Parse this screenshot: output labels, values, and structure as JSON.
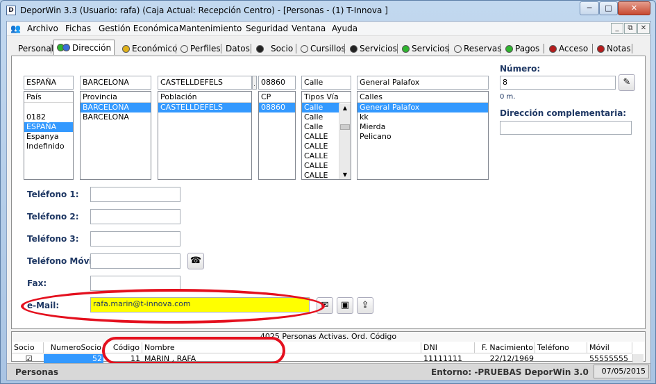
{
  "window": {
    "title": "DeporWin 3.3  (Usuario: rafa)  (Caja Actual: Recepción Centro) - [Personas - (1) T-Innova ]",
    "app_icon": "D",
    "controls": [
      "─",
      "□",
      "✕"
    ]
  },
  "menu": {
    "items": [
      "Archivo",
      "Fichas",
      "Gestión Económica",
      "Mantenimiento",
      "Seguridad",
      "Ventana",
      "Ayuda"
    ],
    "mdi_controls": [
      "_",
      "⧉",
      "✕"
    ]
  },
  "tabs": [
    {
      "label": "Personal",
      "icon": ""
    },
    {
      "label": "Dirección",
      "icon": "green-blue-dots"
    },
    {
      "label": "Económico",
      "icon": "yellow-dot"
    },
    {
      "label": "Perfiles",
      "icon": "white-dot"
    },
    {
      "label": "Datos",
      "icon": ""
    },
    {
      "label": "Socio",
      "icon": "black-dot"
    },
    {
      "label": "Cursillos",
      "icon": "white-dot"
    },
    {
      "label": "Servicios",
      "icon": "black-dot"
    },
    {
      "label": "Servicios",
      "icon": "green-dot"
    },
    {
      "label": "Reservas",
      "icon": "white-dot"
    },
    {
      "label": "Pagos",
      "icon": "green-dot"
    },
    {
      "label": "Acceso",
      "icon": "red-dot"
    },
    {
      "label": "Notas",
      "icon": "red-dot"
    }
  ],
  "address": {
    "pais": {
      "value": "ESPAÑA",
      "header": "País",
      "items": [
        "",
        "0182",
        "ESPAÑA",
        "Espanya",
        "Indefinido"
      ],
      "selected": "ESPAÑA"
    },
    "provincia": {
      "value": "BARCELONA",
      "header": "Provincia",
      "items": [
        "BARCELONA",
        "BARCELONA"
      ],
      "selected": "BARCELONA"
    },
    "poblacion": {
      "value": "CASTELLDEFELS",
      "header": "Población",
      "items": [
        "CASTELLDEFELS"
      ],
      "selected": "CASTELLDEFELS"
    },
    "cp": {
      "value": "08860",
      "header": "CP",
      "items": [
        "08860"
      ],
      "selected": "08860"
    },
    "tipo_via": {
      "value": "Calle",
      "header": "Tipos Vía",
      "items": [
        "Calle",
        "Calle",
        "Calle",
        "CALLE",
        "CALLE",
        "CALLE",
        "CALLE",
        "CALLE"
      ],
      "selected": "Calle"
    },
    "calle": {
      "value": "General Palafox",
      "header": "Calles",
      "items": [
        "General Palafox",
        "kk",
        "Mierda",
        "Pelicano"
      ],
      "selected": "General Palafox"
    },
    "numero": {
      "label": "Número:",
      "value": "8",
      "distance": "0 m."
    },
    "complementaria": {
      "label": "Dirección complementaria:",
      "value": ""
    }
  },
  "contact": {
    "telefono1": {
      "label": "Teléfono 1:",
      "value": ""
    },
    "telefono2": {
      "label": "Teléfono 2:",
      "value": ""
    },
    "telefono3": {
      "label": "Teléfono 3:",
      "value": ""
    },
    "movil": {
      "label": "Teléfono Móvil:",
      "value": ""
    },
    "fax": {
      "label": "Fax:",
      "value": ""
    },
    "email": {
      "label": "e-Mail:",
      "value": "rafa.marin@t-innova.com"
    }
  },
  "grid": {
    "caption": "4025 Personas Activas. Ord. Código",
    "columns": [
      "Socio",
      "NumeroSocio",
      "Código",
      "Nombre",
      "DNI",
      "F. Nacimiento",
      "Teléfono",
      "Móvil"
    ],
    "rows": [
      {
        "socio": "☑",
        "numero_socio": "52",
        "codigo": "11",
        "nombre": "MARIN , RAFA",
        "dni": "11111111",
        "f_nacimiento": "22/12/1969",
        "telefono": "",
        "movil": "55555555"
      }
    ]
  },
  "status": {
    "left": "Personas",
    "entorno": "Entorno: -PRUEBAS DeporWin 3.0",
    "date": "07/05/2015"
  },
  "colors": {
    "email_highlight": "#ffff00",
    "annotation_red": "#e4101e",
    "selection_blue": "#3399ff",
    "label_blue": "#1f3864"
  }
}
